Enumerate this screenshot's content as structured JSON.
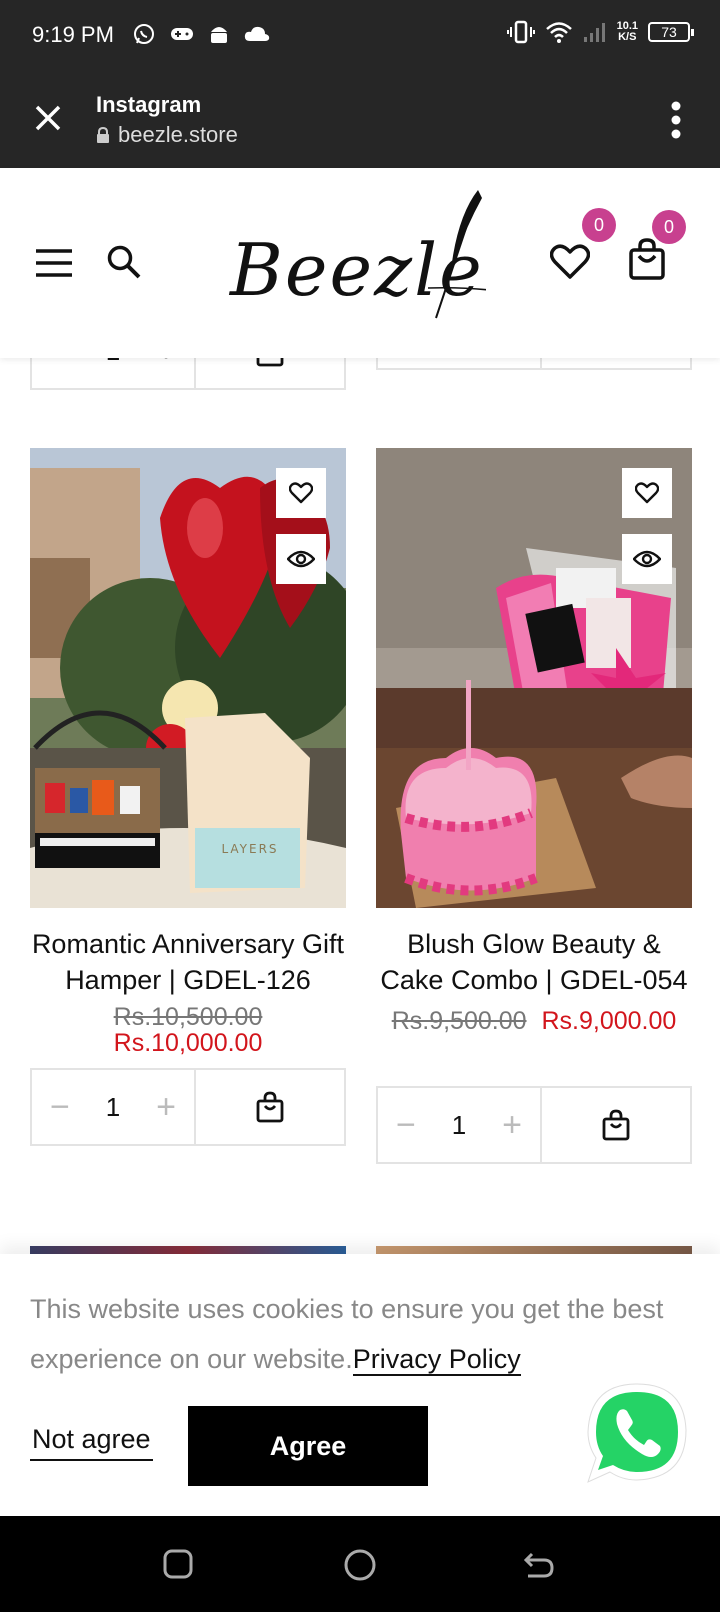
{
  "status": {
    "time": "9:19 PM",
    "net_speed_top": "10.1",
    "net_speed_bottom": "K/S",
    "battery": "73"
  },
  "browser": {
    "title": "Instagram",
    "url": "beezle.store"
  },
  "header": {
    "logo_text": "Beezle",
    "wishlist_count": "0",
    "cart_count": "0"
  },
  "products": [
    {
      "name": "Romantic Anniversary Gift Hamper | GDEL-126",
      "old_price": "Rs.10,500.00",
      "new_price": "Rs.10,000.00",
      "qty": "1",
      "qty_prev": "1"
    },
    {
      "name": "Blush Glow Beauty & Cake Combo | GDEL-054",
      "old_price": "Rs.9,500.00",
      "new_price": "Rs.9,000.00",
      "qty": "1"
    }
  ],
  "cookie": {
    "message": "This website uses cookies to ensure you get the best experience on our website.",
    "privacy_link": "Privacy Policy",
    "not_agree": "Not agree",
    "agree": "Agree"
  },
  "colors": {
    "accent_badge": "#c8408f",
    "sale_price": "#d2151c",
    "whatsapp": "#25d366"
  }
}
